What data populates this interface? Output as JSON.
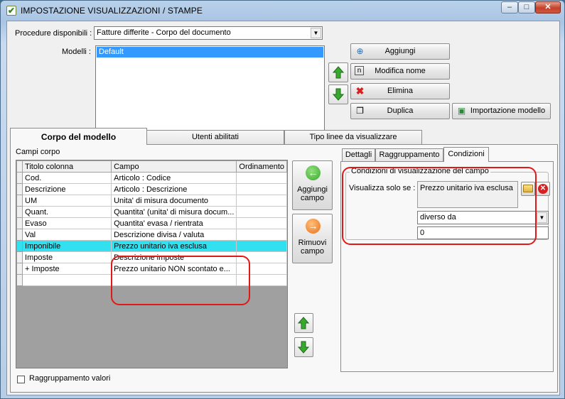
{
  "window": {
    "title": "IMPOSTAZIONE VISUALIZZAZIONI / STAMPE",
    "min": "–",
    "max": "□",
    "close": "✕"
  },
  "top": {
    "procedure_label": "Procedure disponibili :",
    "procedure_value": "Fatture differite - Corpo del documento",
    "modelli_label": "Modelli :",
    "modelli": [
      "Default"
    ],
    "selected_model": "Default",
    "buttons": {
      "aggiungi": "Aggiungi",
      "modifica": "Modifica nome",
      "elimina": "Elimina",
      "duplica": "Duplica",
      "importazione": "Importazione modello"
    }
  },
  "tabs": {
    "corpo": "Corpo del modello",
    "utenti": "Utenti abilitati",
    "tipo": "Tipo linee da visualizzare"
  },
  "campi": {
    "title": "Campi corpo",
    "columns": [
      "Titolo colonna",
      "Campo",
      "Ordinamento"
    ],
    "rows": [
      {
        "titolo": "Cod.",
        "campo": "Articolo : Codice",
        "ordinamento": ""
      },
      {
        "titolo": "Descrizione",
        "campo": "Articolo : Descrizione",
        "ordinamento": ""
      },
      {
        "titolo": "UM",
        "campo": "Unita' di misura documento",
        "ordinamento": ""
      },
      {
        "titolo": "Quant.",
        "campo": "Quantita' (unita' di misura docum...",
        "ordinamento": ""
      },
      {
        "titolo": "Evaso",
        "campo": "Quantita' evasa / rientrata",
        "ordinamento": ""
      },
      {
        "titolo": "Val",
        "campo": "Descrizione divisa / valuta",
        "ordinamento": ""
      },
      {
        "titolo": "Imponibile",
        "campo": "Prezzo unitario iva esclusa",
        "ordinamento": ""
      },
      {
        "titolo": "Imposte",
        "campo": "Descrizione imposte",
        "ordinamento": ""
      },
      {
        "titolo": "+ Imposte",
        "campo": "Prezzo unitario NON scontato e...",
        "ordinamento": ""
      }
    ],
    "selected_row": 6,
    "aggiungi_campo": "Aggiungi campo",
    "rimuovi_campo": "Rimuovi campo",
    "raggruppamento": "Raggruppamento valori"
  },
  "right": {
    "tabs": [
      "Dettagli",
      "Raggruppamento",
      "Condizioni"
    ],
    "active_tab": "Condizioni",
    "group_title": "Condizioni di visualizzazione del campo",
    "visualizza_label": "Visualizza solo se :",
    "field_value": "Prezzo unitario iva esclusa",
    "operator": "diverso da",
    "value": "0"
  },
  "colors": {
    "selection": "#33e0f0",
    "highlight": "#e01818",
    "arrow_green": "#3aa830"
  }
}
